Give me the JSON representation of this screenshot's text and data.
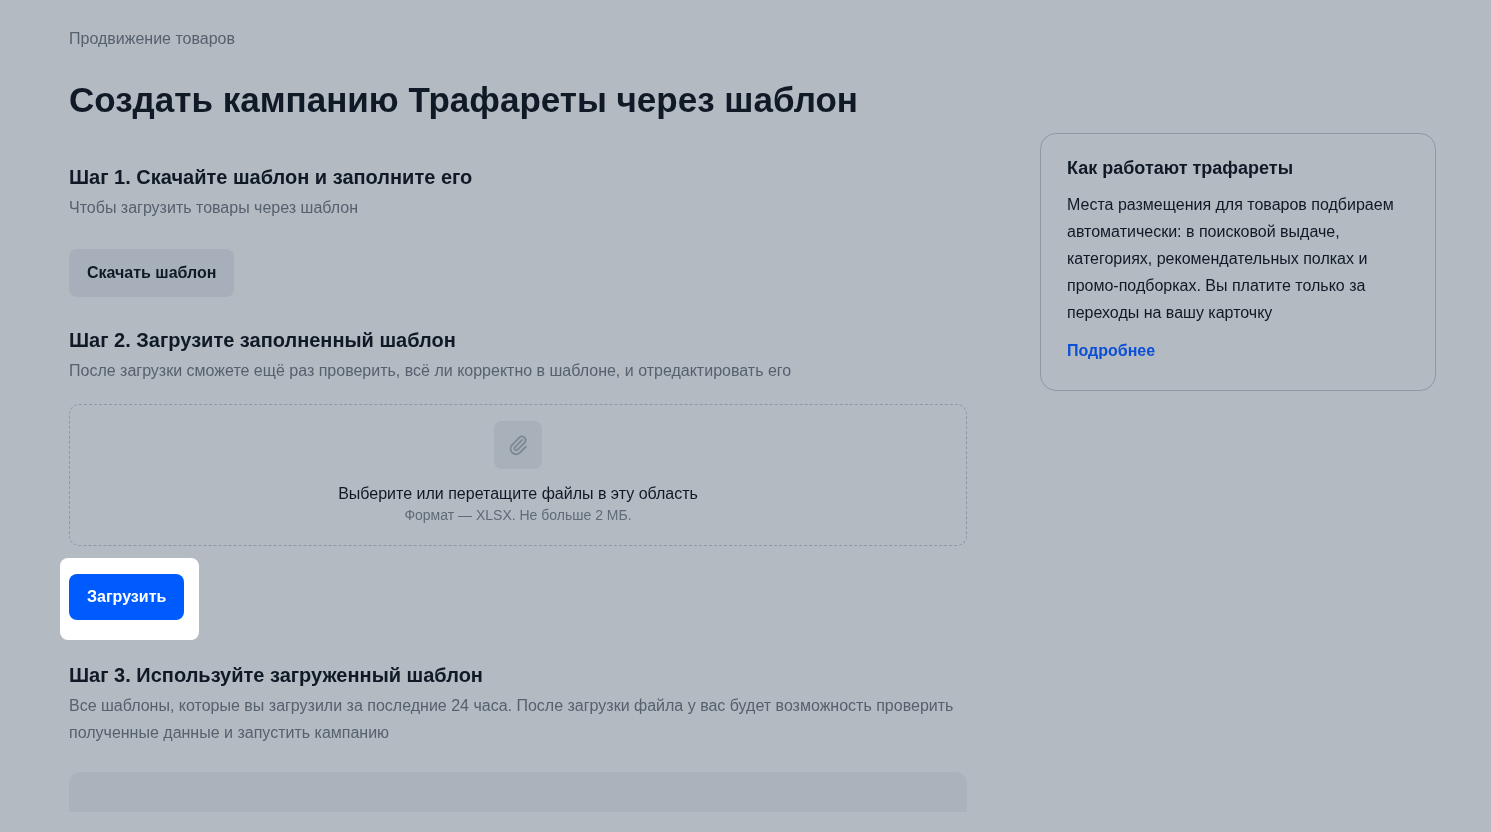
{
  "breadcrumb": "Продвижение товаров",
  "title": "Создать кампанию Трафареты через шаблон",
  "steps": [
    {
      "kind": "download",
      "heading": "Шаг 1. Скачайте шаблон и заполните его",
      "description": "Чтобы загрузить товары через шаблон",
      "button": "Скачать шаблон"
    },
    {
      "kind": "upload",
      "heading": "Шаг 2. Загрузите заполненный шаблон",
      "description": "После загрузки сможете ещё раз проверить, всё ли корректно в шаблоне, и отредактировать его",
      "dropzone": {
        "text": "Выберите или перетащите файлы в эту область",
        "hint": "Формат — XLSX. Не больше 2 МБ."
      },
      "button": "Загрузить",
      "highlighted": true
    },
    {
      "kind": "list",
      "heading": "Шаг 3. Используйте загруженный шаблон",
      "description": "Все шаблоны, которые вы загрузили за последние 24 часа. После загрузки файла у вас будет возможность проверить полученные данные и запустить кампанию"
    }
  ],
  "info_card": {
    "title": "Как работают трафареты",
    "text": "Места размещения для товаров подбираем автоматически: в поисковой выдаче, категориях, рекомендательных полках и промо-подборках. Вы платите только за переходы на вашу карточку",
    "link": "Подробнее"
  }
}
